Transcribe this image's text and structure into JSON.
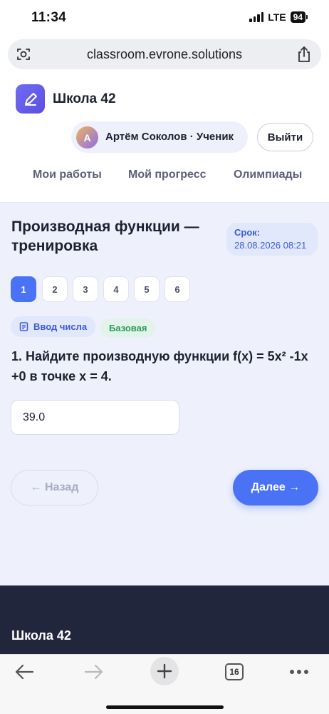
{
  "status_bar": {
    "time": "11:34",
    "network": "LTE",
    "battery": "94"
  },
  "browser": {
    "url": "classroom.evrone.solutions",
    "tabs_count": "16"
  },
  "header": {
    "school_name": "Школа 42",
    "user": {
      "avatar_letter": "A",
      "name": "Артём Соколов · Ученик"
    },
    "logout_label": "Выйти",
    "nav": [
      {
        "label": "Мои работы"
      },
      {
        "label": "Мой прогресс"
      },
      {
        "label": "Олимпиады"
      }
    ]
  },
  "test": {
    "title": "Производная функции — тренировка",
    "deadline_label": "Срок:",
    "deadline_value": "28.08.2026 08:21",
    "questions": [
      {
        "label": "1",
        "active": true
      },
      {
        "label": "2",
        "active": false
      },
      {
        "label": "3",
        "active": false
      },
      {
        "label": "4",
        "active": false
      },
      {
        "label": "5",
        "active": false
      },
      {
        "label": "6",
        "active": false
      }
    ],
    "tag_type": "Ввод числа",
    "tag_level": "Базовая",
    "question_text": "1. Найдите производную функции f(x) = 5x² -1x +0 в точке x = 4.",
    "answer_value": "39.0",
    "back_label": "← Назад",
    "next_label": "Далее →"
  },
  "footer": {
    "title": "Школа 42"
  },
  "colors": {
    "accent": "#4a72f5",
    "accent_text": "#3b5bd9",
    "level_green": "#2b9a5a",
    "footer_bg": "#22263d",
    "page_bg": "#eef1fb"
  },
  "icons": {
    "url_left": "camera-search-icon",
    "url_right": "share-icon",
    "logo": "pencil-icon",
    "tag_type": "document-icon",
    "bottom_bar": [
      "back-arrow-icon",
      "forward-arrow-icon",
      "plus-icon",
      "tabs-icon",
      "more-icon"
    ]
  }
}
